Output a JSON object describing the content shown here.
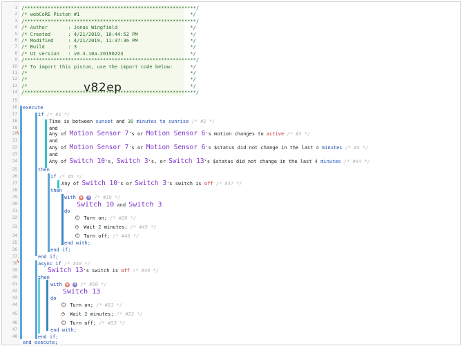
{
  "header_lines": [
    "/***********************************************************/",
    "/* webCoRE Piston #1                                      */",
    "/***********************************************************/",
    "/* Author       : Jonas Wingfield                         */",
    "/* Created      : 4/21/2019, 10:44:52 PM                  */",
    "/* Modified     : 4/21/2019, 11:37:36 PM                  */",
    "/* Build        : 3                                       */",
    "/* UI version   : v0.3.10a.20190223                       */",
    "/***********************************************************/",
    "/* To import this piston, use the import code below:      */",
    "/*                                                        */",
    "/*                                                        */",
    "/*                                                        */",
    "/***********************************************************/"
  ],
  "import_code": "v82ep",
  "code": {
    "execute": "execute",
    "if1": "if",
    "if1_cm": "/* #1 */",
    "cond1": {
      "time": "Time",
      "is_between": " is between ",
      "sunset": "sunset",
      "and": " and ",
      "mins": "30",
      "minutes_to": " minutes to ",
      "sunrise": "sunrise",
      "cm": "/* #2 */"
    },
    "and": "and",
    "cond2": {
      "any": "Any of ",
      "dev1": "Motion Sensor 7",
      "poss": "'s",
      "or": " or ",
      "dev2": "Motion Sensor 6",
      "attr": "'s motion changes to ",
      "val": "active",
      "cm": "/* #3 */"
    },
    "cond3": {
      "any": "Any of ",
      "dev1": "Motion Sensor 7",
      "poss": "'s",
      "or": " or ",
      "dev2": "Motion Sensor 6",
      "attr": "'s $status did not change in the last ",
      "num": "4",
      "unit": " minutes",
      "cm": "/* #4 */"
    },
    "cond4": {
      "any": "Any of ",
      "dev1": "Switch 10",
      "poss1": "'s, ",
      "dev2": "Switch 3",
      "poss2": "'s, or ",
      "dev3": "Switch 13",
      "attr": "'s $status did not change in the last ",
      "num": "4",
      "unit": " minutes",
      "cm": "/* #44 */"
    },
    "then": "then",
    "if5": "if",
    "if5_cm": "/* #5 */",
    "cond5": {
      "any": "Any of ",
      "dev1": "Switch 10",
      "poss1": "'s or ",
      "dev2": "Switch 3",
      "attr": "'s switch is ",
      "val": "off",
      "cm": "/* #47 */"
    },
    "with": "with",
    "with19_cm": "/* #19 */",
    "with19_devices": {
      "d1": "Switch 10",
      "and": " and ",
      "d2": "Switch 3"
    },
    "do": "do",
    "turn_on": "Turn on;",
    "turn_on_cm1": "/* #20 */",
    "wait": "Wait ",
    "wait_num": "2",
    "wait_unit": " minutes;",
    "wait_cm1": "/* #45 */",
    "turn_off": "Turn off;",
    "turn_off_cm1": "/* #46 */",
    "end_with": "end with;",
    "end_if": "end if;",
    "async_if": "async if",
    "async_cm": "/* #48 */",
    "cond6": {
      "dev": "Switch 13",
      "attr": "'s switch is ",
      "val": "off",
      "cm": "/* #49 */"
    },
    "with50_cm": "/* #50 */",
    "with50_device": "Switch 13",
    "turn_on_cm2": "/* #51 */",
    "wait_cm2": "/* #52 */",
    "turn_off_cm2": "/* #53 */",
    "end_execute": "end execute;"
  },
  "line_numbers": [
    "1",
    "2",
    "3",
    "4",
    "5",
    "6",
    "7",
    "8",
    "9",
    "10",
    "11",
    "12",
    "13",
    "14",
    "15",
    "16",
    "17",
    "18",
    "19",
    "20",
    "21",
    "22",
    "23",
    "24",
    "25",
    "26",
    "27",
    "28",
    "29",
    "30",
    "31",
    "32",
    "33",
    "34",
    "35",
    "36",
    "37",
    "38",
    "39",
    "40",
    "41",
    "42",
    "43",
    "44",
    "45",
    "46",
    "47",
    "48"
  ]
}
